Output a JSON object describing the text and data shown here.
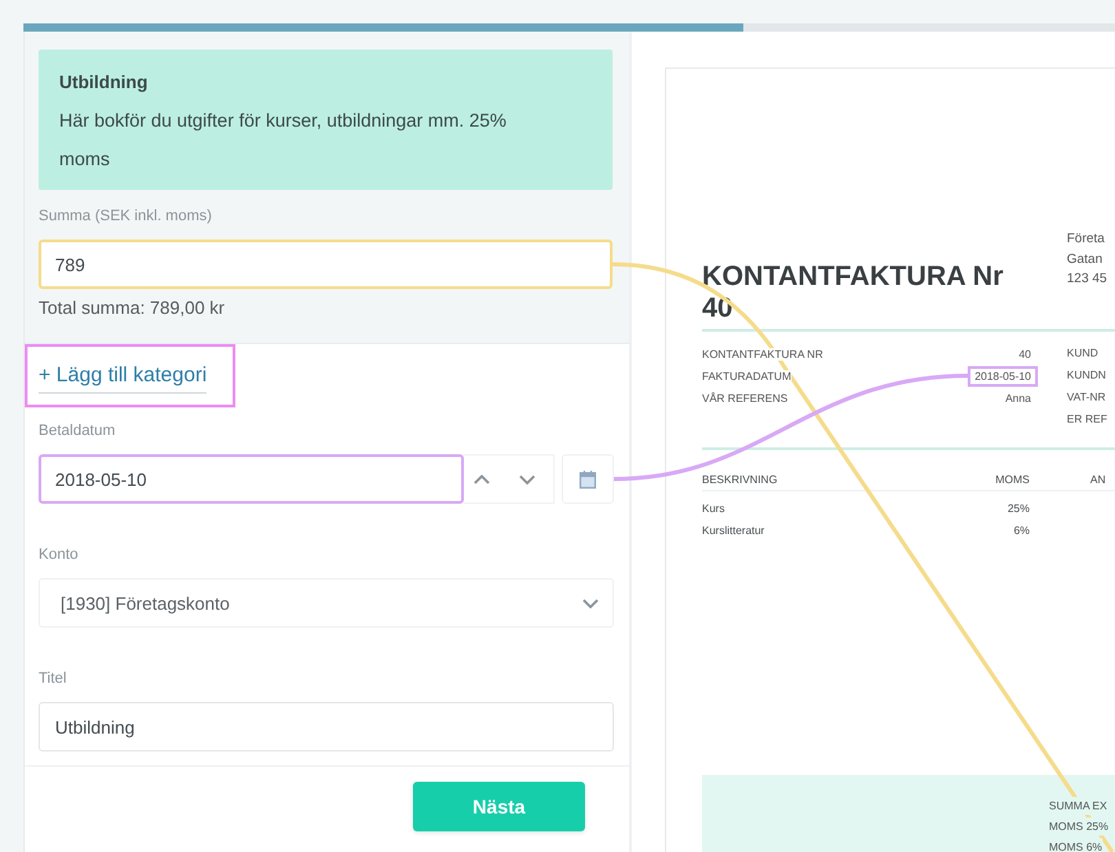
{
  "progress": {
    "level": 0.66
  },
  "category": {
    "title": "Utbildning",
    "description": "Här bokför du utgifter för kurser, utbildningar mm. 25% moms"
  },
  "amount": {
    "label": "Summa (SEK inkl. moms)",
    "value": "789",
    "color": "#f5dc8c",
    "total": "Total summa: 789,00 kr"
  },
  "add_category": {
    "label": "+ Lägg till kategori",
    "color": "#ec8cf3"
  },
  "fields": [
    {
      "kind": "date",
      "label": "Betaldatum",
      "value": "2018-05-10",
      "color": "#d8a9f5"
    },
    {
      "kind": "select",
      "label": "Konto",
      "value": "[1930] Företagskonto"
    },
    {
      "kind": "text",
      "label": "Titel",
      "value": "Utbildning"
    }
  ],
  "next_button": {
    "label": "Nästa"
  },
  "invoice": {
    "title": "KONTANTFAKTURA Nr 40",
    "sender": [
      "Företa",
      "Gatan",
      "123 45"
    ],
    "meta": [
      {
        "label": "KONTANTFAKTURA NR",
        "value": "40"
      },
      {
        "label": "FAKTURADATUM",
        "value": "2018-05-10",
        "color": "#d8a9f5"
      },
      {
        "label": "VÅR REFERENS",
        "value": "Anna"
      }
    ],
    "customer_labels": [
      "KUND",
      "KUNDN",
      "VAT-NR",
      "ER REF"
    ],
    "table": {
      "columns": [
        "BESKRIVNING",
        "MOMS",
        "AN"
      ],
      "rows": [
        [
          "Kurs",
          "25%"
        ],
        [
          "Kurslitteratur",
          "6%"
        ]
      ]
    },
    "totals": [
      "SUMMA EX",
      "MOMS 25%",
      "MOMS 6%"
    ]
  }
}
